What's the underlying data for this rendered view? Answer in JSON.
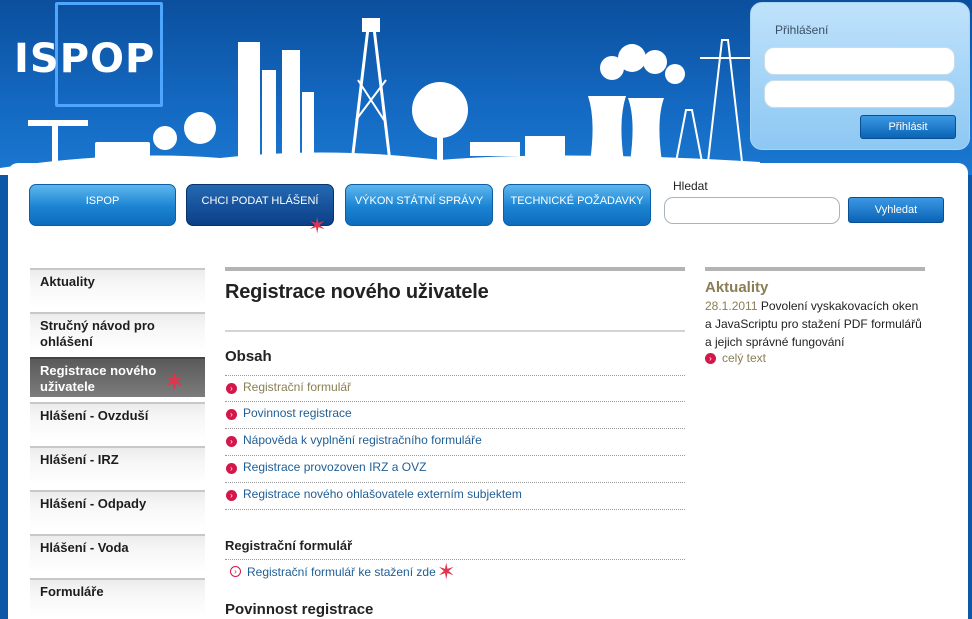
{
  "header": {
    "logo": "ISPOP"
  },
  "login": {
    "title": "Přihlášení",
    "username_value": "",
    "password_value": "",
    "submit_label": "Přihlásit"
  },
  "nav": {
    "items": [
      {
        "label": "ISPOP"
      },
      {
        "label": "CHCI PODAT HLÁŠENÍ"
      },
      {
        "label": "VÝKON STÁTNÍ SPRÁVY"
      },
      {
        "label": "TECHNICKÉ POŽADAVKY"
      }
    ],
    "active_index": 1
  },
  "search": {
    "label": "Hledat",
    "value": "",
    "button_label": "Vyhledat"
  },
  "sidebar": {
    "items": [
      {
        "label": "Aktuality"
      },
      {
        "label": "Stručný návod pro ohlášení"
      },
      {
        "label": "Registrace nového uživatele"
      },
      {
        "label": "Hlášení - Ovzduší"
      },
      {
        "label": "Hlášení - IRZ"
      },
      {
        "label": "Hlášení - Odpady"
      },
      {
        "label": "Hlášení - Voda"
      },
      {
        "label": "Formuláře"
      }
    ],
    "active_index": 2
  },
  "main": {
    "title": "Registrace nového uživatele",
    "toc_heading": "Obsah",
    "toc": [
      {
        "label": "Registrační formulář"
      },
      {
        "label": "Povinnost registrace"
      },
      {
        "label": "Nápověda k vyplnění registračního formuláře"
      },
      {
        "label": "Registrace provozoven IRZ a OVZ"
      },
      {
        "label": "Registrace nového ohlašovatele externím subjektem"
      }
    ],
    "section1_heading": "Registrační formulář",
    "section1_link": "Registrační formulář ke stažení zde",
    "section2_heading": "Povinnost registrace"
  },
  "news": {
    "heading": "Aktuality",
    "date": "28.1.2011",
    "text": "Povolení vyskakovacích oken a JavaScriptu pro stažení PDF formulářů a jejich správné fungování",
    "more": "celý text"
  },
  "colors": {
    "header_blue": "#0b4f9d",
    "nav_blue": "#1a83d1",
    "bullet_red": "#d3174b",
    "visited_olive": "#8a7e54",
    "link_blue": "#1f5e95"
  }
}
